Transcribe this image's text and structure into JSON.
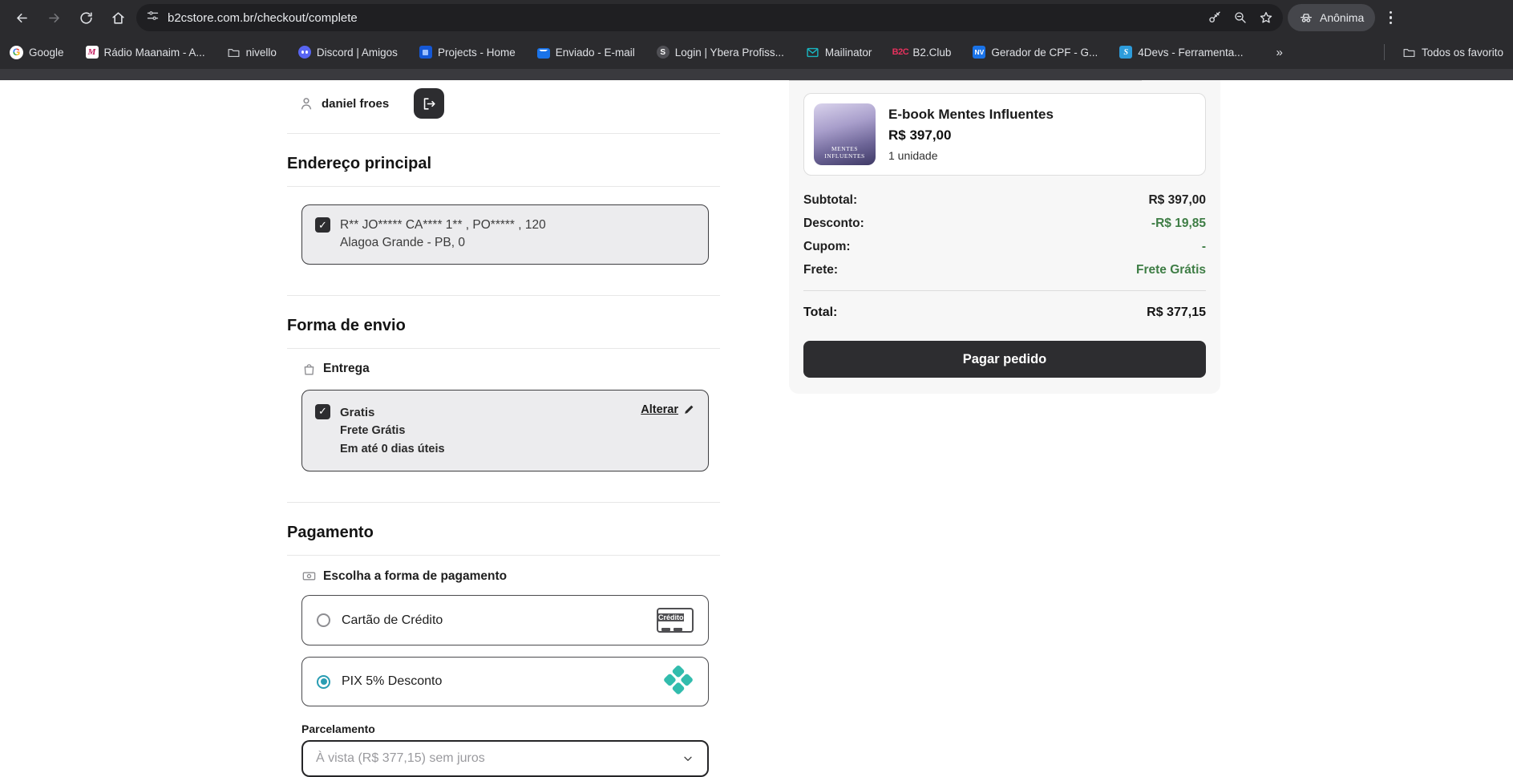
{
  "browser": {
    "url": "b2cstore.com.br/checkout/complete",
    "incognito_label": "Anônima",
    "bookmarks": [
      {
        "label": "Google",
        "icon": "google-icon"
      },
      {
        "label": "Rádio Maanaim - A...",
        "icon": "radio-maanaim-icon"
      },
      {
        "label": "nivello",
        "icon": "folder-icon"
      },
      {
        "label": "Discord | Amigos",
        "icon": "discord-icon"
      },
      {
        "label": "Projects - Home",
        "icon": "projects-icon"
      },
      {
        "label": "Enviado - E-mail",
        "icon": "email-icon"
      },
      {
        "label": "Login | Ybera Profiss...",
        "icon": "ybera-icon"
      },
      {
        "label": "Mailinator",
        "icon": "mailinator-icon"
      },
      {
        "label": "B2.Club",
        "icon": "b2club-icon"
      },
      {
        "label": "Gerador de CPF - G...",
        "icon": "nv-icon"
      },
      {
        "label": "4Devs - Ferramenta...",
        "icon": "4devs-icon"
      }
    ],
    "bookmarks_overflow": "»",
    "all_bookmarks_label": "Todos os favorito"
  },
  "checkout": {
    "user": {
      "name": "daniel froes"
    },
    "address_section": {
      "title": "Endereço principal",
      "address_line1": "R** JO***** CA**** 1** , PO***** , 120",
      "address_line2": "Alagoa Grande - PB, 0",
      "selected": true
    },
    "shipping_section": {
      "title": "Forma de envio",
      "group_label": "Entrega",
      "option": {
        "name": "Gratis",
        "description": "Frete Grátis",
        "eta": "Em até 0 dias úteis",
        "selected": true
      },
      "change_label": "Alterar"
    },
    "payment_section": {
      "title": "Pagamento",
      "group_label": "Escolha a forma de pagamento",
      "options": [
        {
          "label": "Cartão de Crédito",
          "selected": false,
          "badge": "Crédito"
        },
        {
          "label": "PIX 5% Desconto",
          "selected": true
        }
      ],
      "installments_label": "Parcelamento",
      "installments_value": "À vista (R$ 377,15) sem juros"
    }
  },
  "summary": {
    "product": {
      "title": "E-book Mentes Influentes",
      "price": "R$ 397,00",
      "quantity": "1 unidade",
      "cover_text": "MENTES INFLUENTES"
    },
    "rows": [
      {
        "label": "Subtotal:",
        "value": "R$ 397,00"
      },
      {
        "label": "Desconto:",
        "value": "-R$ 19,85"
      },
      {
        "label": "Cupom:",
        "value": "-"
      },
      {
        "label": "Frete:",
        "value": "Frete Grátis"
      }
    ],
    "total": {
      "label": "Total:",
      "value": "R$ 377,15"
    },
    "pay_button": "Pagar pedido"
  },
  "colors": {
    "accent_green": "#3e7d45",
    "pix_teal": "#32BCAD",
    "radio_selected": "#2a9db3",
    "dark_button": "#2d2d30"
  }
}
